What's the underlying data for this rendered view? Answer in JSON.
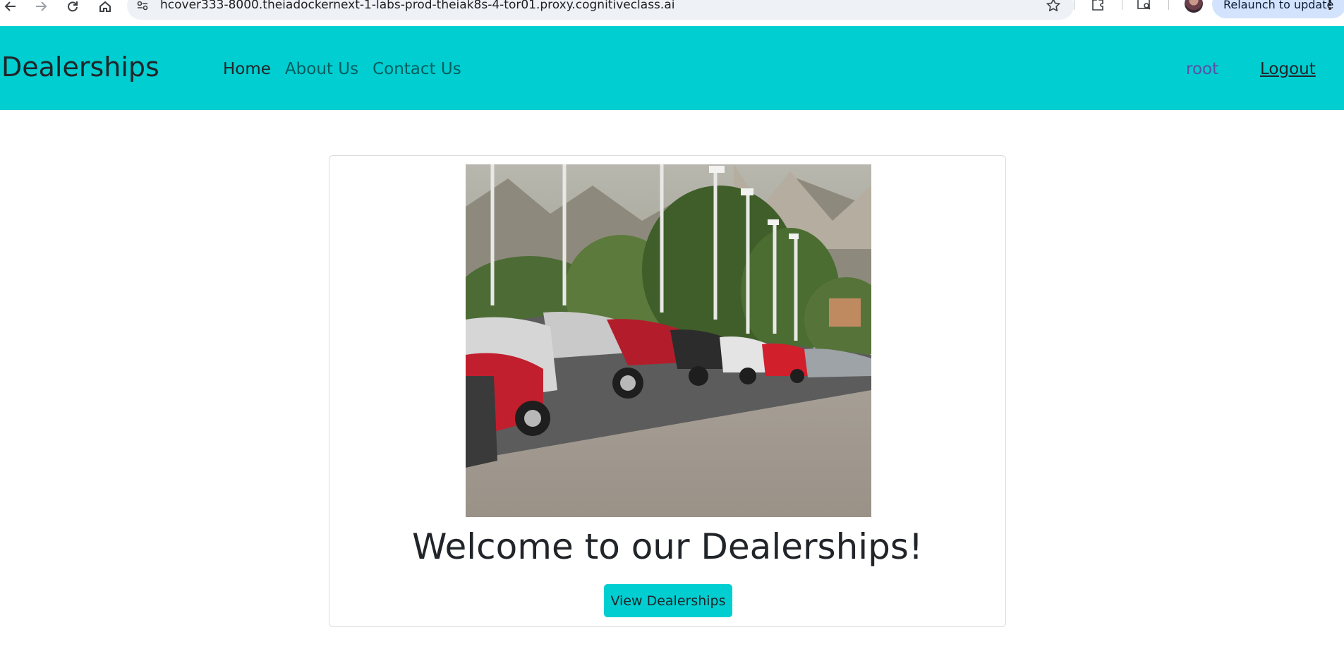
{
  "browser": {
    "url": "hcover333-8000.theiadockernext-1-labs-prod-theiak8s-4-tor01.proxy.cognitiveclass.ai",
    "relaunch_label": "Relaunch to update"
  },
  "navbar": {
    "brand": "Dealerships",
    "links": [
      {
        "label": "Home",
        "active": true
      },
      {
        "label": "About Us",
        "active": false
      },
      {
        "label": "Contact Us",
        "active": false
      }
    ],
    "username": "root",
    "logout_label": "Logout"
  },
  "main": {
    "title": "Welcome to our Dealerships!",
    "button_label": "View Dealerships"
  },
  "colors": {
    "navbar_bg": "#00ced1",
    "button_bg": "#00ced1"
  }
}
